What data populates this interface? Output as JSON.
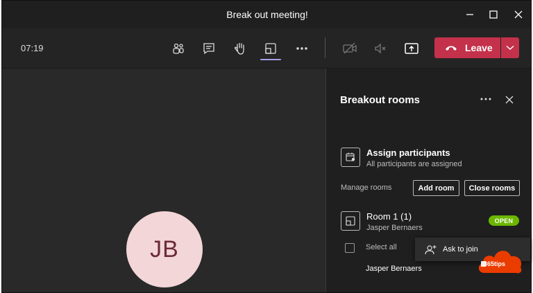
{
  "window": {
    "title": "Break out meeting!"
  },
  "toolbar": {
    "timer": "07:19",
    "leave_label": "Leave"
  },
  "stage": {
    "avatar_initials": "JB"
  },
  "panel": {
    "title": "Breakout rooms",
    "assign": {
      "title": "Assign participants",
      "subtitle": "All participants are assigned"
    },
    "manage_label": "Manage rooms",
    "add_room_label": "Add room",
    "close_rooms_label": "Close rooms",
    "room": {
      "title": "Room 1 (1)",
      "subtitle": "Jasper Bernaers",
      "status": "OPEN"
    },
    "select_all_label": "Select all",
    "member_name": "Jasper Bernaers"
  },
  "popup": {
    "label": "Ask to join"
  },
  "watermark": {
    "text": "365tips"
  },
  "colors": {
    "leave": "#c4314b",
    "open_badge": "#6bb700",
    "active_indicator": "#a5a0e6",
    "watermark": "#eb3c00"
  }
}
